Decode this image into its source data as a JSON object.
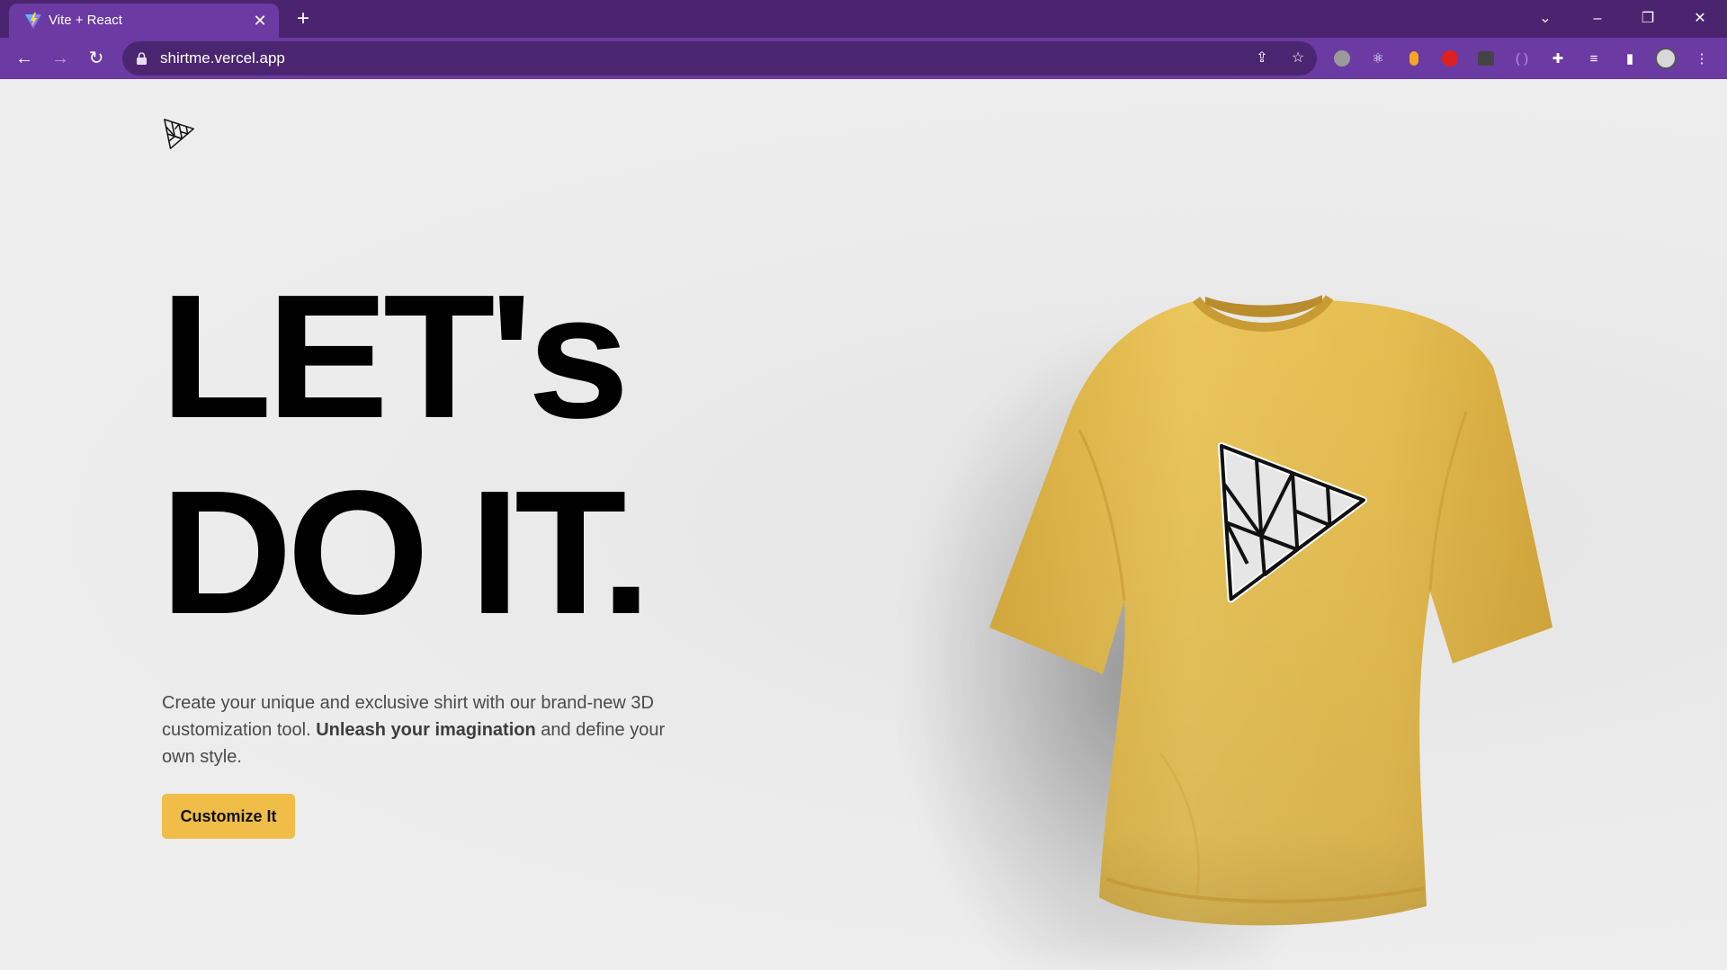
{
  "browser": {
    "tab_title": "Vite + React",
    "url": "shirtme.vercel.app",
    "accent_colors": {
      "tabstrip": "#4b2470",
      "toolbar": "#6b3aa3"
    }
  },
  "icons": {
    "tab_favicon": "vite-icon",
    "back": "arrow-left-icon",
    "forward": "arrow-right-icon",
    "reload": "reload-icon",
    "share": "share-icon",
    "bookmark": "star-icon",
    "extensions": "puzzle-icon",
    "reading_list": "reading-list-icon",
    "side_panel": "side-panel-icon",
    "menu": "kebab-menu-icon"
  },
  "hero": {
    "headline_line1": "LET's",
    "headline_line2": "DO IT.",
    "intro_part1": "Create your unique and exclusive shirt with our brand-new 3D customization tool. ",
    "intro_bold": "Unleash your imagination",
    "intro_part2": " and define your own style.",
    "cta_label": "Customize It",
    "cta_color": "#efbd48"
  },
  "shirt": {
    "color": "#e8c15a",
    "decal": "threejs-triangle-logo"
  }
}
